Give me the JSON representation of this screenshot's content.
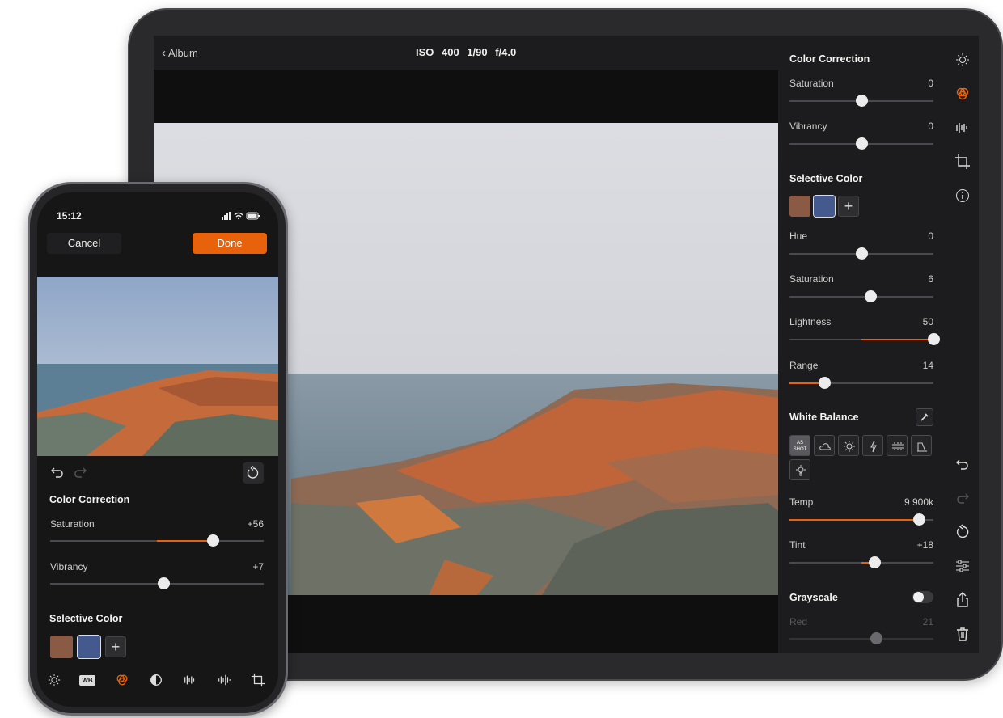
{
  "ipad": {
    "back_label": "Album",
    "exif": "ISO 400   1/90   f/4.0",
    "color_correction": {
      "title": "Color Correction",
      "sliders": [
        {
          "label": "Saturation",
          "value": "0",
          "fraction": 0.5
        },
        {
          "label": "Vibrancy",
          "value": "0",
          "fraction": 0.5
        }
      ]
    },
    "selective_color": {
      "title": "Selective Color",
      "swatches": [
        "#8a5a45",
        "#445a8e"
      ],
      "plus": "+",
      "sliders": [
        {
          "label": "Hue",
          "value": "0",
          "fraction": 0.5
        },
        {
          "label": "Saturation",
          "value": "6",
          "fraction": 0.56
        },
        {
          "label": "Lightness",
          "value": "50",
          "fraction": 1.0
        },
        {
          "label": "Range",
          "value": "14",
          "fraction": 0.24
        }
      ]
    },
    "white_balance": {
      "title": "White Balance",
      "as_shot_line1": "AS",
      "as_shot_line2": "SHOT",
      "presets": [
        "as-shot",
        "cloudy",
        "daylight",
        "flash",
        "fluorescent",
        "shade",
        "tungsten"
      ],
      "sliders": [
        {
          "label": "Temp",
          "value": "9 900k",
          "fraction": 0.9
        },
        {
          "label": "Tint",
          "value": "+18",
          "fraction": 0.59
        }
      ]
    },
    "grayscale": {
      "label": "Grayscale",
      "enabled": false,
      "red_label": "Red",
      "red_value": "21",
      "red_fraction": 0.6
    },
    "rail_icons_top": [
      "light-icon",
      "color-icon",
      "detail-icon",
      "crop-icon",
      "info-icon"
    ],
    "rail_icons_bottom": [
      "undo-icon",
      "redo-icon",
      "revert-icon",
      "adjust-icon",
      "share-icon",
      "trash-icon"
    ]
  },
  "iphone": {
    "time": "15:12",
    "cancel_label": "Cancel",
    "done_label": "Done",
    "color_correction": {
      "title": "Color Correction",
      "sliders": [
        {
          "label": "Saturation",
          "value": "+56",
          "fraction": 0.76
        },
        {
          "label": "Vibrancy",
          "value": "+7",
          "fraction": 0.53
        }
      ]
    },
    "selective_color": {
      "title": "Selective Color",
      "swatches": [
        "#8a5a45",
        "#445a8e"
      ],
      "plus": "+"
    },
    "toolbar_wb_label": "WB",
    "toolbar_icons": [
      "light-icon",
      "wb-icon",
      "color-icon",
      "contrast-icon",
      "detail-icon",
      "noise-icon",
      "crop-icon"
    ]
  },
  "colors": {
    "accent": "#e8620c",
    "panel": "#1c1c1e",
    "screen": "#0f0f10"
  }
}
